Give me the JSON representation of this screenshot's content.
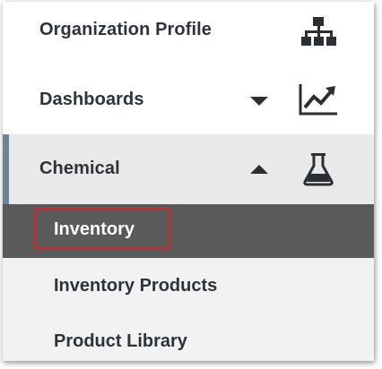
{
  "nav": {
    "items": [
      {
        "label": "Organization Profile",
        "icon": "org-chart-icon"
      },
      {
        "label": "Dashboards",
        "icon": "line-chart-icon",
        "state": "collapsed"
      },
      {
        "label": "Chemical",
        "icon": "flask-icon",
        "state": "expanded"
      }
    ],
    "chemical_sub": [
      {
        "label": "Inventory",
        "active": true
      },
      {
        "label": "Inventory Products",
        "active": false
      },
      {
        "label": "Product Library",
        "active": false
      }
    ]
  },
  "colors": {
    "active_sub_bg": "#5a5a5a",
    "sub_bg": "#f2f2f2",
    "expanded_bg": "#e9e9e9",
    "left_bar": "#6d8499",
    "highlight": "#d9262b",
    "text": "#2f3338"
  }
}
